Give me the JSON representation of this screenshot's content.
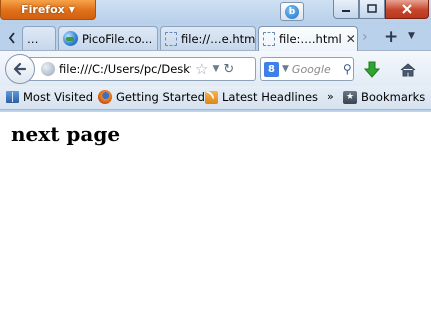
{
  "titlebar": {
    "app_button_label": "Firefox"
  },
  "tabs": [
    {
      "label": "…",
      "active": false
    },
    {
      "label": "PicoFile.co...",
      "active": false
    },
    {
      "label": "file://…e.html",
      "active": false
    },
    {
      "label": "file:….html",
      "active": true
    }
  ],
  "tab_close_glyph": "✕",
  "navbar": {
    "url": "file:///C:/Users/pc/Deskt",
    "search_placeholder": "Google"
  },
  "bookmarks": {
    "items": [
      {
        "label": "Most Visited",
        "icon": "bookmarks-folder-icon"
      },
      {
        "label": "Getting Started",
        "icon": "firefox-icon"
      },
      {
        "label": "Latest Headlines",
        "icon": "rss-icon"
      }
    ],
    "overflow_glyph": "»",
    "menu_label": "Bookmarks"
  },
  "page": {
    "heading": "next page"
  },
  "colors": {
    "firefox_orange": "#e0701a",
    "chrome_blue": "#b9d1ea",
    "close_red": "#c7452b",
    "download_green": "#2fa62f"
  }
}
